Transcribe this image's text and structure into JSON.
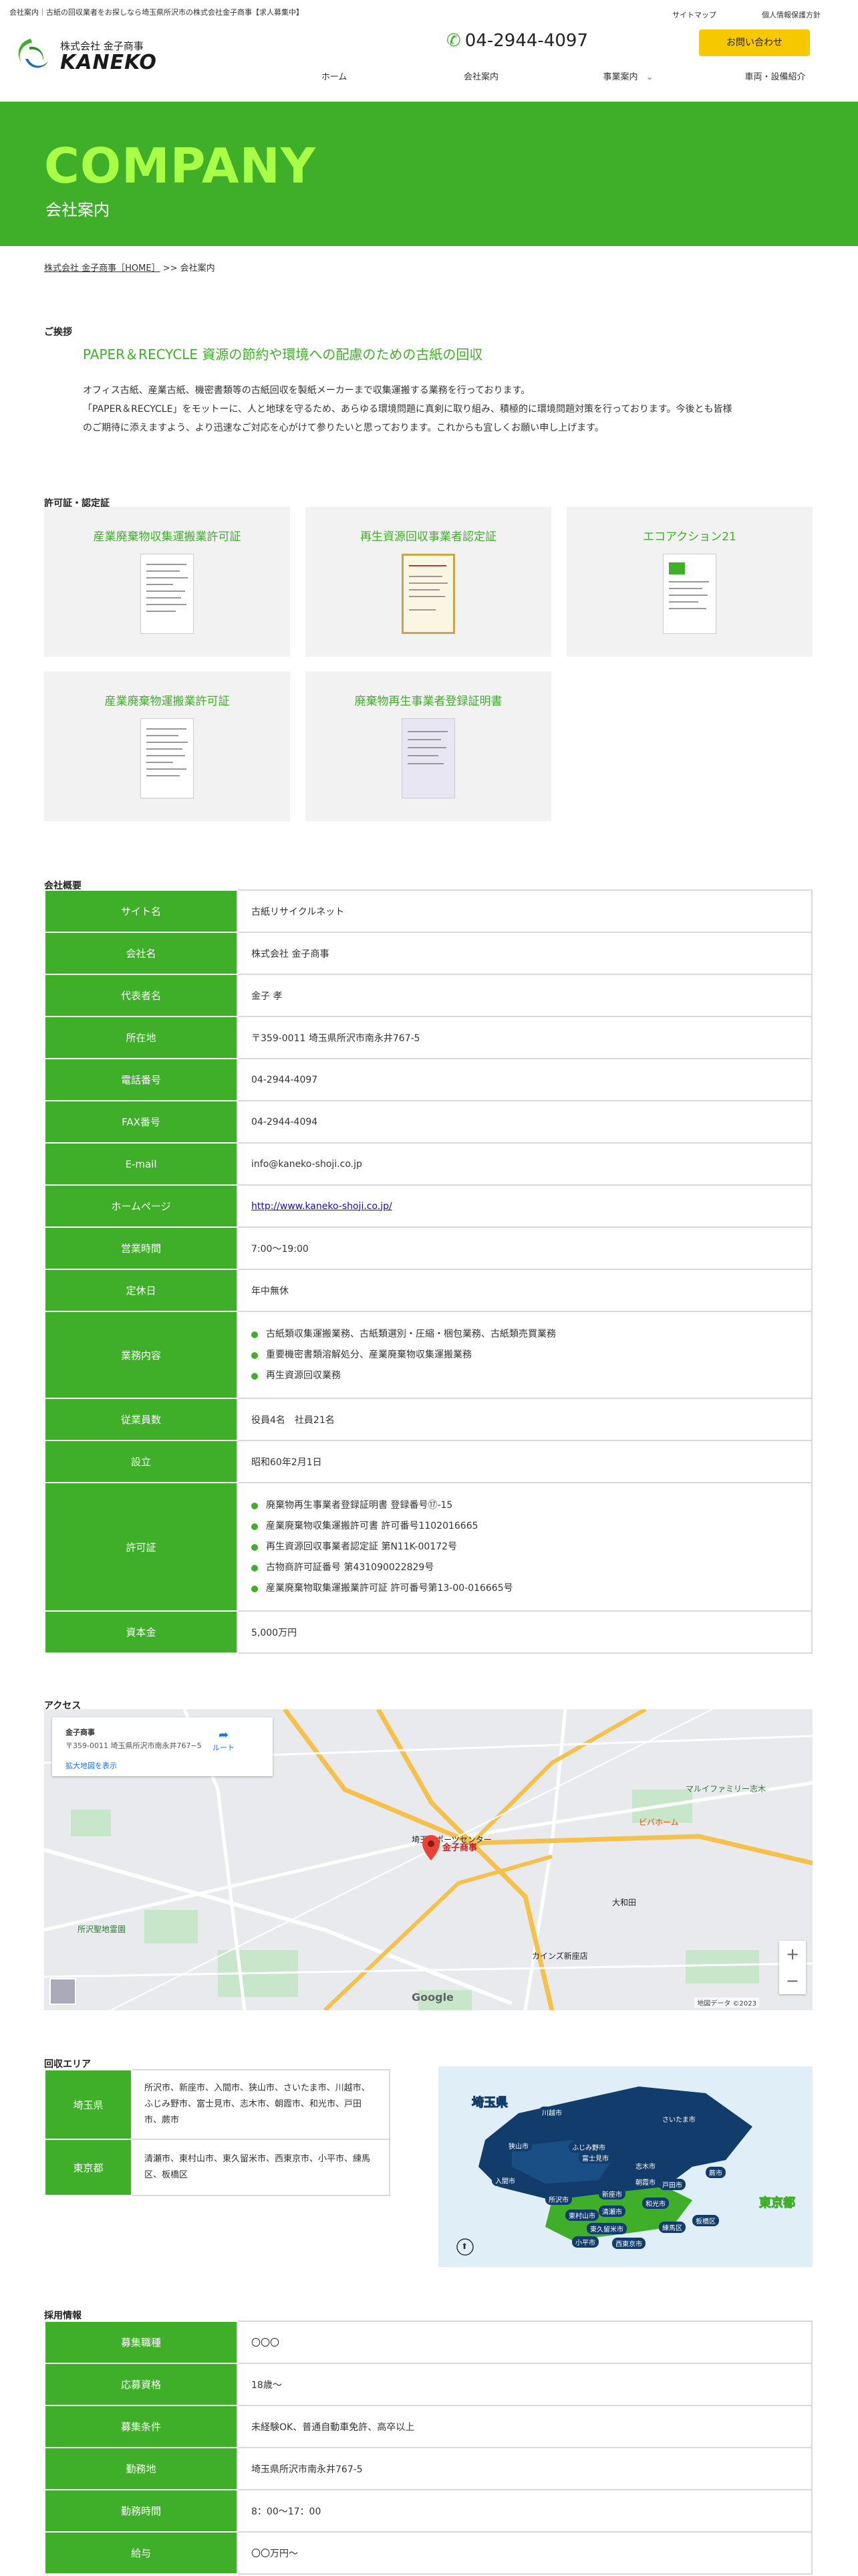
{
  "topbar": {
    "tagline": "会社案内｜古紙の回収業者をお探しなら埼玉県所沢市の株式会社金子商事【求人募集中】",
    "sitemap": "サイトマップ",
    "privacy": "個人情報保護方針"
  },
  "header": {
    "company_small": "株式会社 金子商事",
    "logo_text": "KANEKO",
    "phone": "04-2944-4097",
    "contact_label": "お問い合わせ"
  },
  "nav": [
    "ホーム",
    "会社案内",
    "事業案内",
    "車両・設備紹介"
  ],
  "hero": {
    "en": "COMPANY",
    "ja": "会社案内"
  },
  "breadcrumb": {
    "home": "株式会社 金子商事［HOME］",
    "sep": ">>",
    "current": "会社案内"
  },
  "greeting": {
    "heading": "ご挨拶",
    "title": "PAPER＆RECYCLE 資源の節約や環境への配慮のための古紙の回収",
    "line1": "オフィス古紙、産業古紙、機密書類等の古紙回収を製紙メーカーまで収集運搬する業務を行っております。",
    "line2": "「PAPER＆RECYCLE」をモットーに、人と地球を守るため、あらゆる環境問題に真剣に取り組み、積極的に環境問題対策を行っております。今後とも皆様",
    "line3": "のご期待に添えますよう、より迅速なご対応を心がけて参りたいと思っております。これからも宜しくお願い申し上げます。"
  },
  "licenses": {
    "heading": "許可証・認定証",
    "items": [
      "産業廃棄物収集運搬業許可証",
      "再生資源回収事業者認定証",
      "エコアクション21",
      "産業廃棄物運搬業許可証",
      "廃棄物再生事業者登録証明書"
    ]
  },
  "overview": {
    "heading": "会社概要",
    "rows": [
      {
        "k": "サイト名",
        "v": "古紙リサイクルネット"
      },
      {
        "k": "会社名",
        "v": "株式会社 金子商事"
      },
      {
        "k": "代表者名",
        "v": "金子 孝"
      },
      {
        "k": "所在地",
        "v": "〒359-0011 埼玉県所沢市南永井767-5"
      },
      {
        "k": "電話番号",
        "v": "04-2944-4097"
      },
      {
        "k": "FAX番号",
        "v": "04-2944-4094"
      },
      {
        "k": "E-mail",
        "v": "info@kaneko-shoji.co.jp"
      },
      {
        "k": "ホームページ",
        "v": "http://www.kaneko-shoji.co.jp/"
      },
      {
        "k": "営業時間",
        "v": "7:00～19:00"
      },
      {
        "k": "定休日",
        "v": "年中無休"
      },
      {
        "k": "業務内容",
        "list": [
          "古紙類収集運搬業務、古紙類選別・圧縮・梱包業務、古紙類売買業務",
          "重要機密書類溶解処分、産業廃棄物収集運搬業務",
          "再生資源回収業務"
        ]
      },
      {
        "k": "従業員数",
        "v": "役員4名　社員21名"
      },
      {
        "k": "設立",
        "v": "昭和60年2月1日"
      },
      {
        "k": "許可証",
        "list": [
          "廃棄物再生事業者登録証明書 登録番号⑰-15",
          "産業廃棄物収集運搬許可書 許可番号1102016665",
          "再生資源回収事業者認定証 第N11K-00172号",
          "古物商許可証番号 第431090022829号",
          "産業廃棄物取集運搬業許可証 許可番号第13-00-016665号"
        ]
      },
      {
        "k": "資本金",
        "v": "5,000万円"
      }
    ]
  },
  "access": {
    "heading": "アクセス",
    "card_name": "金子商事",
    "card_addr": "〒359-0011 埼玉県所沢市南永井767−5",
    "card_link": "拡大地図を表示",
    "card_route": "ルート",
    "pin_label": "金子商事",
    "place_1": "埼玉スポーツセンター",
    "place_2": "所沢聖地霊園",
    "place_3": "カインズ新座店",
    "place_4": "大和田",
    "place_5": "マルイファミリー志木",
    "place_6": "ビバホーム",
    "zoom_in": "+",
    "zoom_out": "−",
    "google": "Google",
    "copyright": "地図データ ©2023"
  },
  "area": {
    "heading": "回収エリア",
    "rows": [
      {
        "k": "埼玉県",
        "v": "所沢市、新座市、入間市、狭山市、さいたま市、川越市、ふじみ野市、富士見市、志木市、朝霞市、和光市、戸田市、蕨市"
      },
      {
        "k": "東京都",
        "v": "清瀬市、東村山市、東久留米市、西東京市、小平市、練馬区、板橋区"
      }
    ],
    "map_saitama": "埼玉県",
    "map_tokyo": "東京都",
    "map_labels": [
      "川越市",
      "さいたま市",
      "狭山市",
      "ふじみ野市",
      "富士見市",
      "志木市",
      "入間市",
      "所沢市",
      "新座市",
      "朝霞市",
      "戸田市",
      "和光市",
      "蕨市",
      "東村山市",
      "清瀬市",
      "板橋区",
      "東久留米市",
      "練馬区",
      "小平市",
      "西東京市"
    ]
  },
  "recruit": {
    "heading": "採用情報",
    "rows": [
      {
        "k": "募集職種",
        "v": "〇〇〇"
      },
      {
        "k": "応募資格",
        "v": "18歳～"
      },
      {
        "k": "募集条件",
        "v": "未経験OK、普通自動車免許、高卒以上"
      },
      {
        "k": "勤務地",
        "v": "埼玉県所沢市南永井767-5"
      },
      {
        "k": "勤務時間",
        "v": "8：00～17：00"
      },
      {
        "k": "給与",
        "v": "〇〇万円～"
      }
    ]
  }
}
